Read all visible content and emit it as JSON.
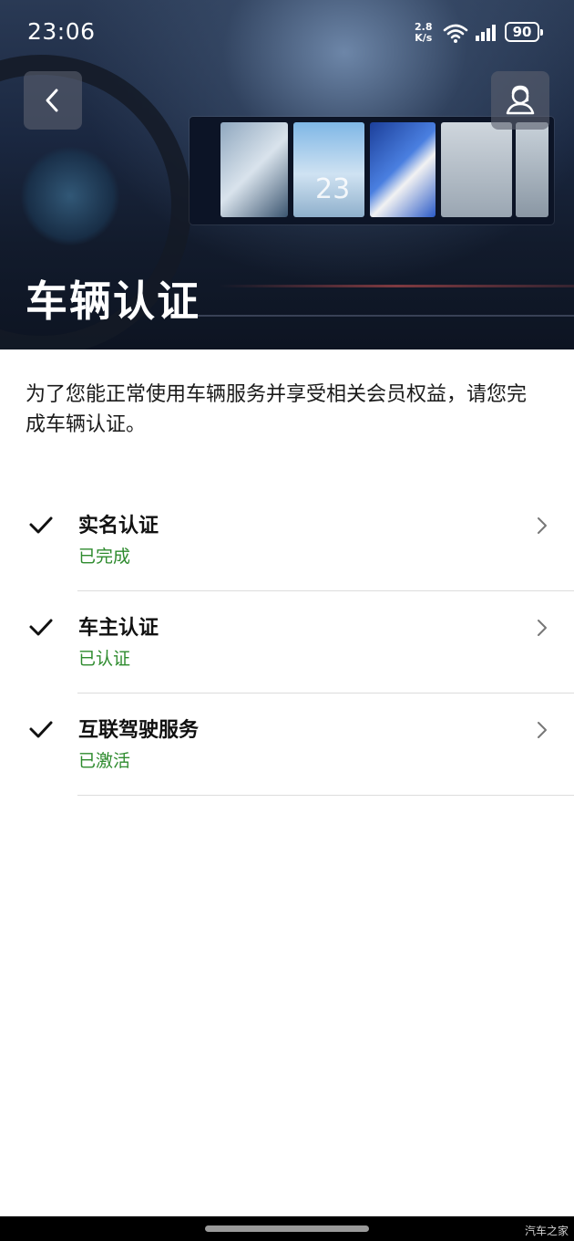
{
  "status_bar": {
    "time": "23:06",
    "net_speed_value": "2.8",
    "net_speed_unit": "K/s",
    "battery": "90"
  },
  "header": {
    "title": "车辆认证",
    "dashboard_number": "23"
  },
  "intro_text": "为了您能正常使用车辆服务并享受相关会员权益，请您完成车辆认证。",
  "steps": [
    {
      "title": "实名认证",
      "status": "已完成"
    },
    {
      "title": "车主认证",
      "status": "已认证"
    },
    {
      "title": "互联驾驶服务",
      "status": "已激活"
    }
  ],
  "watermark": "汽车之家",
  "colors": {
    "status_green": "#2e8b2e",
    "divider": "#dcdcdc"
  }
}
